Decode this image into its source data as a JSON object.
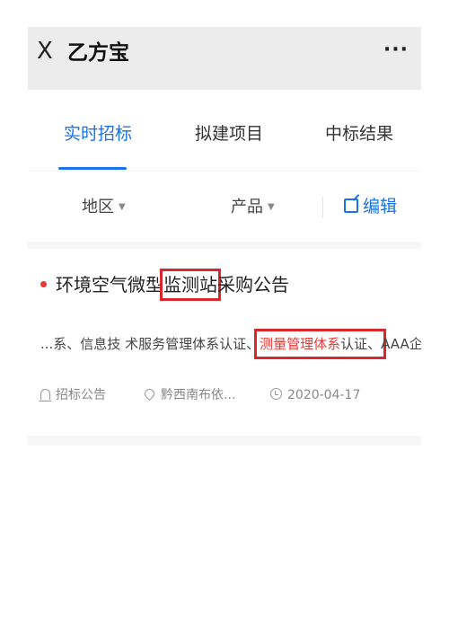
{
  "titlebar": {
    "close_symbol": "X",
    "title": "乙方宝",
    "more_symbol": "···"
  },
  "tabs": [
    {
      "label": "实时招标",
      "active": true
    },
    {
      "label": "拟建项目",
      "active": false
    },
    {
      "label": "中标结果",
      "active": false
    }
  ],
  "filters": {
    "region_label": "地区",
    "product_label": "产品",
    "caret": "▼",
    "edit_label": "编辑"
  },
  "listing": {
    "title_pre": "环境空气微型",
    "title_highlight": "监测站",
    "title_post": "采购公告",
    "snippet_pre": "...系、信息技 术服务管理体系认证、",
    "snippet_highlight": "测量管理体系",
    "snippet_highlight_suffix": "认证、",
    "snippet_post": "AAA企...",
    "type": "招标公告",
    "location": "黔西南布依...",
    "date": "2020-04-17"
  },
  "colors": {
    "accent": "#1a73e8",
    "highlight_red": "#e53935",
    "annotation_box": "#d9272e"
  },
  "icons": [
    "close-icon",
    "more-icon",
    "edit-icon",
    "bell-icon",
    "location-pin-icon",
    "clock-icon",
    "caret-down-icon"
  ]
}
